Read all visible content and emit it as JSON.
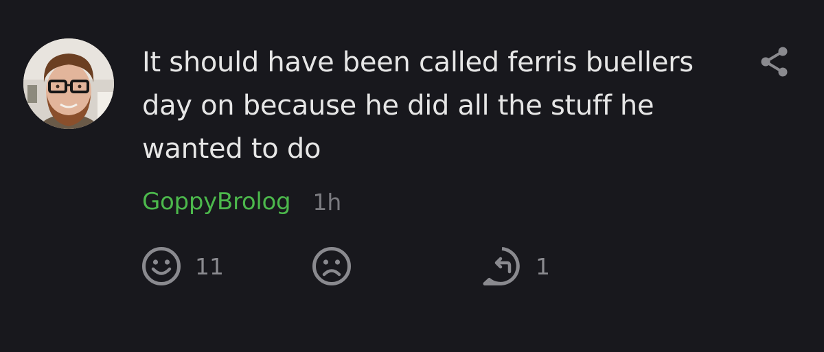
{
  "comment": {
    "text": "It should have been called ferris buellers day on because he did all the stuff he wanted to do",
    "username": "GoppyBrolog",
    "time": "1h"
  },
  "actions": {
    "like": {
      "icon": "smile-icon",
      "count": "11"
    },
    "dislike": {
      "icon": "frown-icon",
      "count": ""
    },
    "reply": {
      "icon": "reply-icon",
      "count": "1"
    }
  },
  "share": {
    "icon": "share-icon"
  },
  "colors": {
    "background": "#18181d",
    "text": "#e6e6e6",
    "username": "#4cb84c",
    "muted": "#7b7b80",
    "icon": "#8a8a8f"
  }
}
